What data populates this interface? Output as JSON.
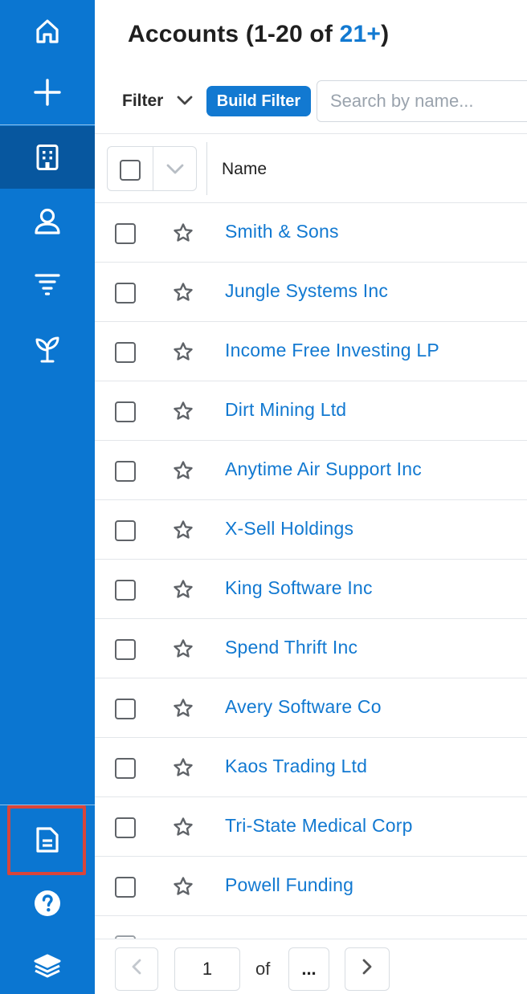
{
  "sidebar": {
    "items": [
      {
        "name": "home",
        "icon": "home-icon"
      },
      {
        "name": "create",
        "icon": "plus-icon"
      },
      {
        "name": "accounts",
        "icon": "building-icon",
        "active": true
      },
      {
        "name": "contacts",
        "icon": "user-icon"
      },
      {
        "name": "leads",
        "icon": "funnel-icon"
      },
      {
        "name": "opportunities",
        "icon": "sprout-icon"
      },
      {
        "name": "documents",
        "icon": "document-icon",
        "highlighted": true
      },
      {
        "name": "help",
        "icon": "help-icon"
      },
      {
        "name": "layers",
        "icon": "layers-icon"
      }
    ],
    "bg_color": "#0b76d1",
    "active_color": "#07579f",
    "highlight_color": "#d9453a"
  },
  "header": {
    "title_prefix": "Accounts (1-20 of ",
    "title_count": "21+",
    "title_suffix": ")"
  },
  "filter": {
    "label": "Filter",
    "build_filter_label": "Build Filter",
    "search_placeholder": "Search by name..."
  },
  "table": {
    "columns": [
      "Name"
    ],
    "rows": [
      {
        "name": "Smith & Sons"
      },
      {
        "name": "Jungle Systems Inc"
      },
      {
        "name": "Income Free Investing LP"
      },
      {
        "name": "Dirt Mining Ltd"
      },
      {
        "name": "Anytime Air Support Inc"
      },
      {
        "name": "X-Sell Holdings"
      },
      {
        "name": "King Software Inc"
      },
      {
        "name": "Spend Thrift Inc"
      },
      {
        "name": "Avery Software Co"
      },
      {
        "name": "Kaos Trading Ltd"
      },
      {
        "name": "Tri-State Medical Corp"
      },
      {
        "name": "Powell Funding"
      }
    ]
  },
  "pagination": {
    "current_page": "1",
    "of_label": "of",
    "more_label": "..."
  },
  "colors": {
    "link": "#1279d1",
    "accent": "#1279d1"
  }
}
